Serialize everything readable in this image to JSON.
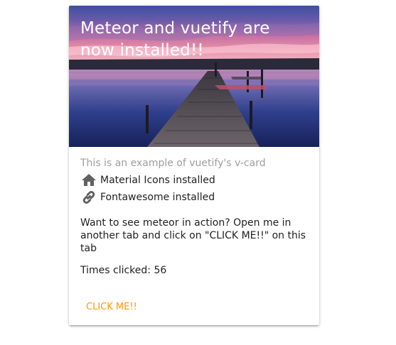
{
  "card": {
    "title": "Meteor and vuetify are now installed!!",
    "subtitle": "This is an example of vuetify's v-card",
    "features": [
      {
        "icon": "home-icon",
        "label": "Material Icons installed"
      },
      {
        "icon": "link-icon",
        "label": "Fontawesome installed"
      }
    ],
    "description": "Want to see meteor in action? Open me in another tab and click on \"CLICK ME!!\" on this tab",
    "counter_text": "Times clicked: 56",
    "button_label": "CLICK ME!!"
  },
  "colors": {
    "accent": "#ff9800",
    "subtitle": "#9e9e9e",
    "icon": "#616161"
  }
}
